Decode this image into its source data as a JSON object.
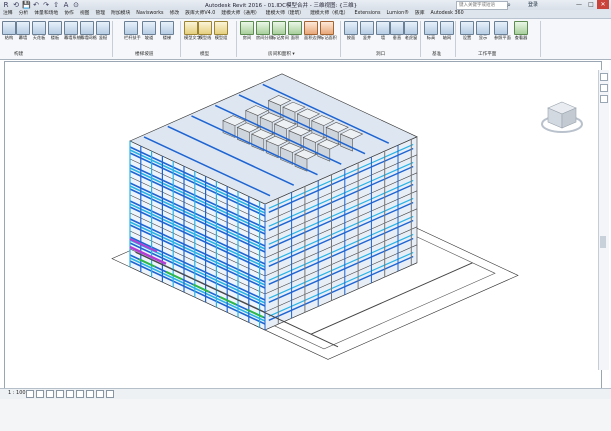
{
  "app": {
    "title": "Autodesk Revit 2016 -      01.IDC模型合并 - 三维视图: {三维}",
    "search_placeholder": "键入关键字或短语",
    "user_label": "登录",
    "window_buttons": [
      "—",
      "□",
      "✕"
    ]
  },
  "quick_access": [
    "R",
    "⟲",
    "💾",
    "↶",
    "↷",
    "⇧",
    "A",
    "⊙"
  ],
  "tabs": [
    "注释",
    "分析",
    "体量和场地",
    "协作",
    "视图",
    "管理",
    "附加模块",
    "Navisworks",
    "修改",
    "族库大师V4.0",
    "建模大师（通用）",
    "建模大师（建筑）",
    "建模大师（机电）",
    "Extensions",
    "Lumion®",
    "族库",
    "Autodesk 360"
  ],
  "active_tab_index": -1,
  "ribbon": {
    "buttons": [
      {
        "label": "结构",
        "color": "b"
      },
      {
        "label": "幕墙",
        "color": "b"
      },
      {
        "label": "天花板",
        "color": "b"
      },
      {
        "label": "楼板",
        "color": "b"
      },
      {
        "label": "幕墙系统",
        "color": "b"
      },
      {
        "label": "幕墙网格",
        "color": "b"
      },
      {
        "label": "竖梃",
        "color": "b"
      },
      {
        "label": "栏杆扶手",
        "color": "b"
      },
      {
        "label": "坡道",
        "color": "b"
      },
      {
        "label": "楼梯",
        "color": "b"
      },
      {
        "label": "模型文字",
        "color": "y"
      },
      {
        "label": "模型线",
        "color": "y"
      },
      {
        "label": "模型组",
        "color": "y"
      },
      {
        "label": "房间",
        "color": "g"
      },
      {
        "label": "房间分隔",
        "color": "g"
      },
      {
        "label": "标记房间",
        "color": "g"
      },
      {
        "label": "面积",
        "color": "g"
      },
      {
        "label": "面积边界",
        "color": "o"
      },
      {
        "label": "标记面积",
        "color": "o"
      },
      {
        "label": "按面",
        "color": "b"
      },
      {
        "label": "竖井",
        "color": "b"
      },
      {
        "label": "墙",
        "color": "b"
      },
      {
        "label": "垂直",
        "color": "b"
      },
      {
        "label": "老虎窗",
        "color": "b"
      },
      {
        "label": "标高",
        "color": "b"
      },
      {
        "label": "轴网",
        "color": "b"
      },
      {
        "label": "设置",
        "color": "b"
      },
      {
        "label": "显示",
        "color": "b"
      },
      {
        "label": "参照平面",
        "color": "b"
      },
      {
        "label": "查看器",
        "color": "g"
      }
    ],
    "panels": [
      "构建",
      "楼梯坡道",
      "模型",
      "房间和面积 ▾",
      "洞口",
      "基准",
      "工作平面"
    ]
  },
  "status": {
    "scale": "1 : 100"
  },
  "model": {
    "description_colors": {
      "pipe_blue": "#1e64d2",
      "cyan": "#28b4e6",
      "green": "#2fb84a",
      "magenta": "#b43cd2",
      "structure": "#555555"
    }
  }
}
